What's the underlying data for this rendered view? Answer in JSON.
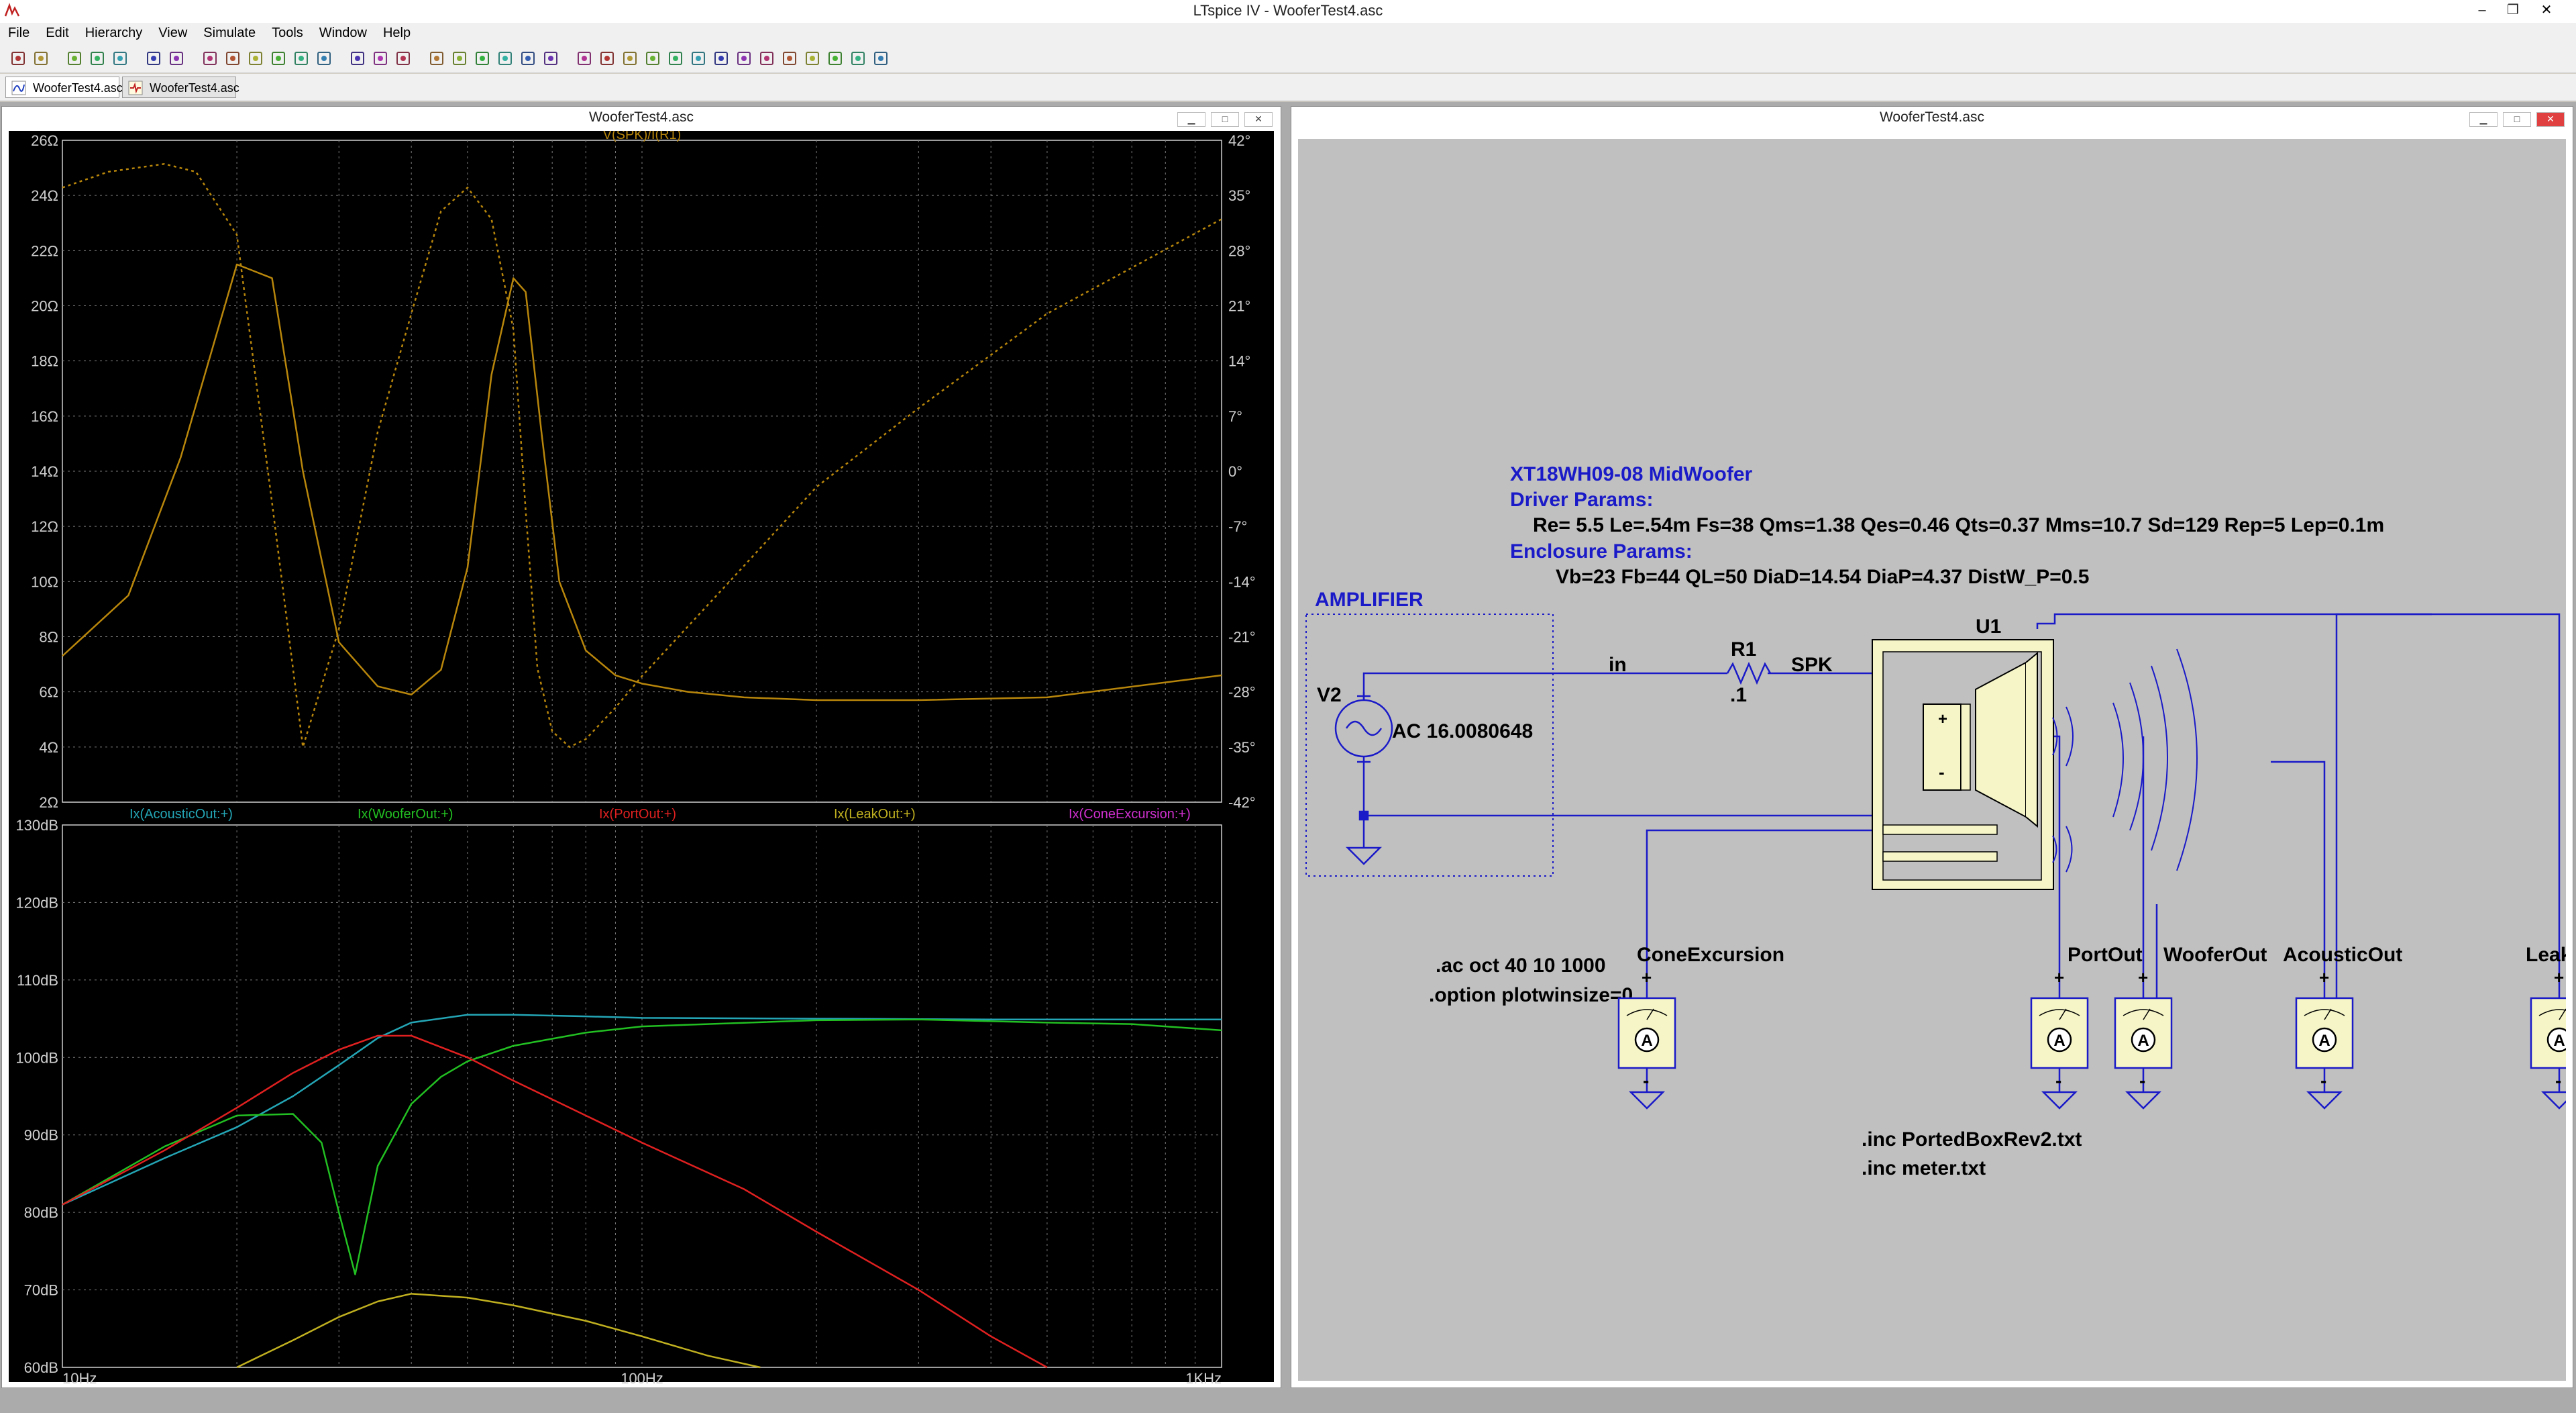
{
  "app": {
    "title": "LTspice IV - WooferTest4.asc"
  },
  "menu": [
    "File",
    "Edit",
    "Hierarchy",
    "View",
    "Simulate",
    "Tools",
    "Window",
    "Help"
  ],
  "toolbar_icons": [
    "new-schematic-icon",
    "open-icon",
    "save-icon",
    "control-panel-icon",
    "run-icon",
    "halt-icon",
    "zoom-in-icon",
    "pan-icon",
    "zoom-out-icon",
    "zoom-fit-icon",
    "autorange-icon",
    "tile-horizontal-icon",
    "cascade-icon",
    "tile-vertical-icon",
    "cut-icon",
    "copy-icon",
    "paste-icon",
    "find-icon",
    "print-setup-icon",
    "print-icon",
    "wire-icon",
    "ground-icon",
    "label-icon",
    "resistor-icon",
    "capacitor-icon",
    "inductor-icon",
    "diode-icon",
    "component-icon",
    "move-icon",
    "drag-icon",
    "undo-icon",
    "redo-icon",
    "rotate-icon",
    "mirror-icon",
    "text-icon",
    "spice-directive-icon"
  ],
  "tabs": [
    {
      "label": "WooferTest4.asc",
      "icon": "waveform-icon",
      "active": true
    },
    {
      "label": "WooferTest4.asc",
      "icon": "schematic-icon",
      "active": false
    }
  ],
  "plot_window": {
    "title": "WooferTest4.asc",
    "colors": {
      "background": "#000000",
      "grid": "#7a7a7a",
      "axis": "#cfcfcf",
      "impedance": "#b8860b",
      "acoustic": "#24a6b6",
      "woofer": "#22c022",
      "port": "#e02020",
      "leak": "#c0b020",
      "cone": "#d030d0"
    }
  },
  "chart_data": [
    {
      "type": "line",
      "title": "V(SPK)/I(R1)",
      "x_scale": "log",
      "xlim": [
        10,
        1000
      ],
      "y_ticks": [
        "26Ω",
        "24Ω",
        "22Ω",
        "20Ω",
        "18Ω",
        "16Ω",
        "14Ω",
        "12Ω",
        "10Ω",
        "8Ω",
        "6Ω",
        "4Ω",
        "2Ω"
      ],
      "y2_ticks": [
        "42°",
        "35°",
        "28°",
        "21°",
        "14°",
        "7°",
        "0°",
        "-7°",
        "-14°",
        "-21°",
        "-28°",
        "-35°",
        "-42°"
      ],
      "ylim": [
        2,
        26
      ],
      "y2lim": [
        -42,
        42
      ],
      "grid": true,
      "series": [
        {
          "name": "V(SPK)/I(R1)",
          "style": "solid",
          "axis": "left",
          "x": [
            10,
            13,
            16,
            20,
            23,
            26,
            30,
            35,
            40,
            45,
            50,
            55,
            60,
            63,
            67,
            72,
            80,
            90,
            100,
            120,
            150,
            200,
            300,
            500,
            1000
          ],
          "y": [
            7.3,
            9.5,
            14.5,
            21.5,
            21.0,
            14.0,
            7.8,
            6.2,
            5.9,
            6.8,
            10.5,
            17.5,
            21.0,
            20.5,
            15.5,
            10.0,
            7.5,
            6.6,
            6.3,
            6.0,
            5.8,
            5.7,
            5.7,
            5.8,
            6.6
          ]
        },
        {
          "name": "V(SPK)/I(R1)",
          "style": "dashed",
          "axis": "right",
          "x": [
            10,
            12,
            15,
            17,
            20,
            23,
            26,
            30,
            35,
            40,
            45,
            50,
            55,
            60,
            63,
            66,
            70,
            75,
            80,
            90,
            100,
            150,
            200,
            300,
            500,
            1000
          ],
          "y": [
            36,
            38,
            39,
            38,
            30,
            -4,
            -35,
            -20,
            5,
            20,
            33,
            36,
            32,
            18,
            -5,
            -25,
            -33,
            -35,
            -34,
            -30,
            -26,
            -12,
            -2,
            8,
            20,
            32
          ]
        }
      ]
    },
    {
      "type": "line",
      "x_scale": "log",
      "xlim": [
        10,
        1000
      ],
      "ylim": [
        60,
        130
      ],
      "y_ticks": [
        "130dB",
        "120dB",
        "110dB",
        "100dB",
        "90dB",
        "80dB",
        "70dB",
        "60dB"
      ],
      "x_ticks": [
        "10Hz",
        "100Hz",
        "1KHz"
      ],
      "grid": true,
      "series": [
        {
          "name": "Ix(AcousticOut:+)",
          "x": [
            10,
            15,
            20,
            25,
            30,
            35,
            40,
            50,
            60,
            80,
            100,
            200,
            400,
            1000
          ],
          "y": [
            81,
            87,
            91,
            95,
            99,
            102.5,
            104.5,
            105.5,
            105.5,
            105.3,
            105.1,
            105.0,
            104.9,
            104.9
          ]
        },
        {
          "name": "Ix(WooferOut:+)",
          "x": [
            10,
            15,
            20,
            25,
            28,
            30,
            32,
            35,
            40,
            45,
            50,
            60,
            80,
            100,
            200,
            300,
            500,
            700,
            1000
          ],
          "y": [
            81,
            88.5,
            92.5,
            92.7,
            89,
            80,
            72,
            86,
            94,
            97.5,
            99.5,
            101.5,
            103.2,
            104,
            104.8,
            104.9,
            104.5,
            104.3,
            103.5
          ]
        },
        {
          "name": "Ix(PortOut:+)",
          "x": [
            10,
            15,
            20,
            25,
            30,
            35,
            40,
            50,
            60,
            80,
            100,
            150,
            200,
            300,
            400,
            500
          ],
          "y": [
            81,
            88,
            93.5,
            98,
            101,
            102.8,
            102.8,
            100,
            97,
            92.5,
            89,
            83,
            77.5,
            70,
            64,
            60
          ]
        },
        {
          "name": "Ix(LeakOut:+)",
          "x": [
            20,
            25,
            30,
            35,
            40,
            50,
            60,
            80,
            100,
            130,
            160
          ],
          "y": [
            60,
            63.5,
            66.5,
            68.5,
            69.5,
            69,
            68,
            66,
            64,
            61.5,
            60
          ]
        },
        {
          "name": "Ix(ConeExcursion:+)",
          "x": [],
          "y": []
        }
      ]
    }
  ],
  "schematic_window": {
    "title": "WooferTest4.asc",
    "labels": {
      "part_title": "XT18WH09-08 MidWoofer",
      "driver_header": "Driver Params:",
      "driver_params": "Re= 5.5 Le=.54m  Fs=38 Qms=1.38 Qes=0.46 Qts=0.37 Mms=10.7 Sd=129 Rep=5 Lep=0.1m",
      "enclosure_header": "Enclosure Params:",
      "enclosure_params": "Vb=23 Fb=44 QL=50 DiaD=14.54 DiaP=4.37 DistW_P=0.5",
      "amplifier": "AMPLIFIER",
      "v2_name": "V2",
      "v2_value": "AC 16.0080648",
      "net_in": "in",
      "r1_name": "R1",
      "r1_value": ".1",
      "net_spk": "SPK",
      "u1_name": "U1",
      "directive_ac": ".ac oct 40 10 1000",
      "directive_option": ".option plotwinsize=0",
      "directive_inc1": ".inc PortedBoxRev2.txt",
      "directive_inc2": ".inc meter.txt"
    },
    "meters": [
      "ConeExcursion",
      "PortOut",
      "WooferOut",
      "AcousticOut",
      "LeakOut"
    ],
    "colors": {
      "background": "#c0c0c0",
      "wire": "#1a1aa8",
      "text_blue": "#1a1ac8",
      "component": "#f5f5c8",
      "text": "#000000"
    }
  }
}
